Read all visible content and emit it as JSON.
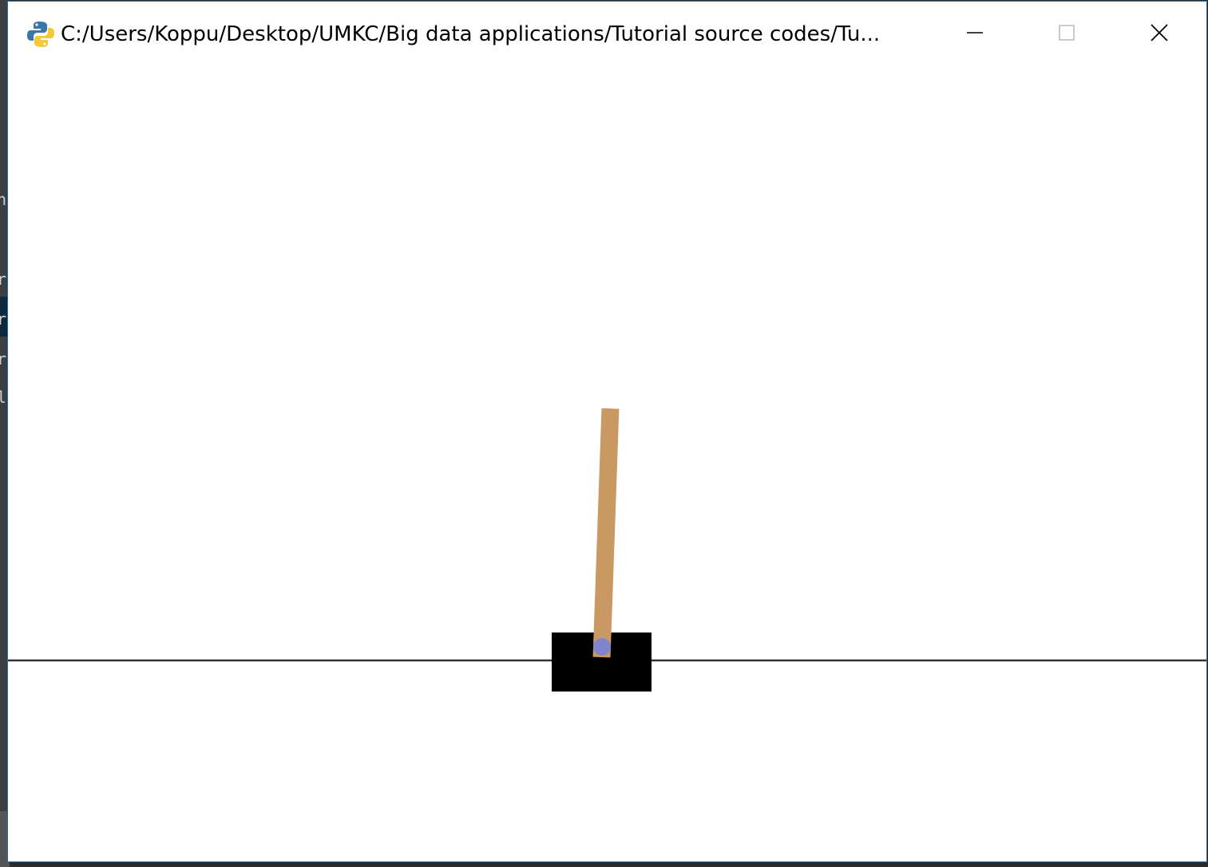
{
  "window": {
    "title": "C:/Users/Koppu/Desktop/UMKC/Big data applications/Tutorial source codes/Tu...",
    "icon": "python-icon",
    "controls": {
      "minimize": "minimize-icon",
      "maximize": "maximize-icon",
      "close": "close-icon"
    }
  },
  "scene": {
    "environment": "cart-pole",
    "colors": {
      "background": "#ffffff",
      "track": "#333333",
      "cart": "#000000",
      "pole": "#ca9862",
      "axle": "#8184cb"
    },
    "pole_tilt_degrees": 2
  }
}
